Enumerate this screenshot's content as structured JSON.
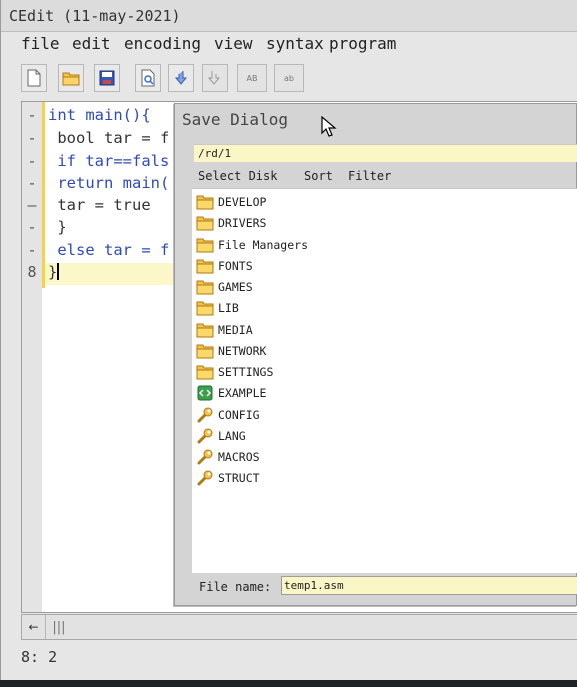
{
  "window": {
    "title": "CEdit (11-may-2021)"
  },
  "menu": {
    "items": [
      "file",
      "edit",
      "encoding",
      "view",
      "syntax",
      "program"
    ]
  },
  "toolbar": {
    "buttons": [
      "new-file-icon",
      "open-folder-icon",
      "save-icon",
      "preview-icon",
      "import-icon",
      "export-icon",
      "uppercase-icon",
      "lowercase-icon"
    ],
    "uppercase_label": "AB",
    "lowercase_label": "ab"
  },
  "editor": {
    "lines": [
      {
        "num": "-",
        "text": "int main(){"
      },
      {
        "num": "-",
        "text": " bool tar = f"
      },
      {
        "num": "-",
        "text": " if tar==fals"
      },
      {
        "num": "-",
        "text": " return main("
      },
      {
        "num": "—",
        "text": " tar = true"
      },
      {
        "num": "-",
        "text": " }"
      },
      {
        "num": "-",
        "text": " else tar = f"
      },
      {
        "num": "8",
        "text": "}"
      }
    ],
    "keyword_color": "#2f4bb5",
    "current_line_color": "#fbf7c8"
  },
  "status": {
    "position": "8: 2"
  },
  "dialog": {
    "title": "Save Dialog",
    "path": "/rd/1",
    "menu": [
      "Select Disk",
      "Sort",
      "Filter"
    ],
    "files": [
      {
        "name": "DEVELOP",
        "icon": "folder-icon"
      },
      {
        "name": "DRIVERS",
        "icon": "folder-icon"
      },
      {
        "name": "File Managers",
        "icon": "folder-icon"
      },
      {
        "name": "FONTS",
        "icon": "folder-icon"
      },
      {
        "name": "GAMES",
        "icon": "folder-icon"
      },
      {
        "name": "LIB",
        "icon": "folder-icon"
      },
      {
        "name": "MEDIA",
        "icon": "folder-icon"
      },
      {
        "name": "NETWORK",
        "icon": "folder-icon"
      },
      {
        "name": "SETTINGS",
        "icon": "folder-icon"
      },
      {
        "name": "EXAMPLE",
        "icon": "code-file-icon"
      },
      {
        "name": "CONFIG",
        "icon": "wrench-icon"
      },
      {
        "name": "LANG",
        "icon": "wrench-icon"
      },
      {
        "name": "MACROS",
        "icon": "wrench-icon"
      },
      {
        "name": "STRUCT",
        "icon": "wrench-icon"
      }
    ],
    "filename_label": "File name:",
    "filename_value": "temp1.asm"
  },
  "scrollbar": {
    "left_arrow": "←",
    "thumb": "|||"
  }
}
